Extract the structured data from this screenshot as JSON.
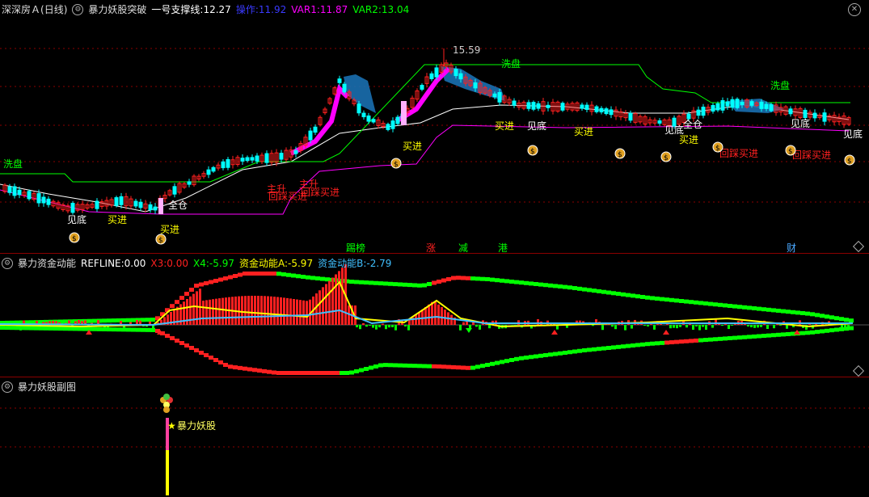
{
  "panel1": {
    "stock_name": "深深房Ａ",
    "period": "(日线)",
    "indicator": "暴力妖股突破",
    "support_label": "一号支撑线:",
    "support_value": "12.27",
    "op_label": "操作:",
    "op_value": "11.92",
    "var1_label": "VAR1:",
    "var1_value": "11.87",
    "var2_label": "VAR2:",
    "var2_value": "13.04",
    "high_price": "15.59",
    "wash_label": "洗盘",
    "buy_label": "买进",
    "bottom_label": "见底",
    "full_label": "全仓",
    "rise_label": "主升",
    "pullback_label": "回踩买进",
    "markers": [
      "踢榜",
      "涨",
      "减",
      "港",
      "财"
    ]
  },
  "panel2": {
    "indicator": "暴力资金动能",
    "refline_label": "REFLINE:",
    "refline_value": "0.00",
    "x3_label": "X3:",
    "x3_value": "0.00",
    "x4_label": "X4:",
    "x4_value": "-5.97",
    "a_label": "资金动能A:",
    "a_value": "-5.97",
    "b_label": "资金动能B:",
    "b_value": "-2.79"
  },
  "panel3": {
    "indicator": "暴力妖股副图",
    "signal_label": "暴力妖股"
  },
  "colors": {
    "up": "#ff2020",
    "down": "#00ffff",
    "magenta": "#ff00ff",
    "green": "#00ff00",
    "yellow": "#ffff00",
    "white": "#ffffff"
  }
}
